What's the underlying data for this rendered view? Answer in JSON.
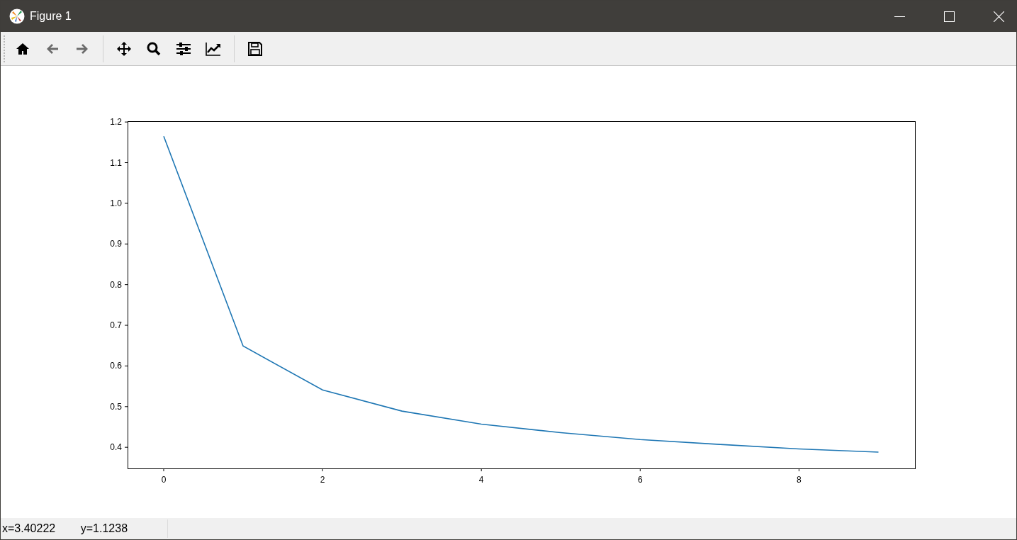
{
  "window": {
    "title": "Figure 1"
  },
  "toolbar": [
    {
      "kind": "home",
      "disabled": false
    },
    {
      "kind": "back",
      "disabled": true
    },
    {
      "kind": "forward",
      "disabled": true
    },
    {
      "kind": "separator"
    },
    {
      "kind": "pan",
      "disabled": false
    },
    {
      "kind": "zoom",
      "disabled": false
    },
    {
      "kind": "configure",
      "disabled": false
    },
    {
      "kind": "edit-axes",
      "disabled": false
    },
    {
      "kind": "separator"
    },
    {
      "kind": "save",
      "disabled": false
    }
  ],
  "chart_data": {
    "type": "line",
    "x": [
      0,
      1,
      2,
      3,
      4,
      5,
      6,
      7,
      8,
      9
    ],
    "series": [
      {
        "color": "#1f77b4",
        "values": [
          1.165,
          0.649,
          0.541,
          0.489,
          0.457,
          0.436,
          0.419,
          0.407,
          0.396,
          0.388
        ]
      }
    ],
    "xlim": [
      -0.455,
      9.46
    ],
    "ylim": [
      0.348,
      1.202
    ],
    "xticks": [
      0,
      2,
      4,
      6,
      8
    ],
    "yticks": [
      {
        "value": 0.4,
        "label": "0.4"
      },
      {
        "value": 0.5,
        "label": "0.5"
      },
      {
        "value": 0.6,
        "label": "0.6"
      },
      {
        "value": 0.7,
        "label": "0.7"
      },
      {
        "value": 0.8,
        "label": "0.8"
      },
      {
        "value": 0.9,
        "label": "0.9"
      },
      {
        "value": 1.0,
        "label": "1.0"
      },
      {
        "value": 1.1,
        "label": "1.1"
      },
      {
        "value": 1.2,
        "label": "1.2"
      }
    ]
  },
  "status_bar": {
    "coordinates": "x=3.40222        y=1.1238"
  }
}
